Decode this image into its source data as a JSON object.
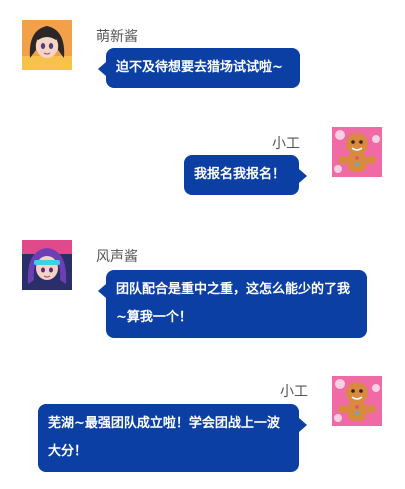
{
  "messages": [
    {
      "sender": "萌新酱",
      "text": "迫不及待想要去猎场试试啦~",
      "side": "left",
      "avatar": "anime-girl-avatar"
    },
    {
      "sender": "小工",
      "text": "我报名我报名！",
      "side": "right",
      "avatar": "gingerbread-avatar"
    },
    {
      "sender": "风声酱",
      "text": "团队配合是重中之重，这怎么能少的了我~算我一个！",
      "side": "left",
      "avatar": "purple-hair-girl-avatar"
    },
    {
      "sender": "小工",
      "text": "芜湖~最强团队成立啦！学会团战上一波大分！",
      "side": "right",
      "avatar": "gingerbread-avatar"
    }
  ],
  "colors": {
    "bubble": "#0b3fa3",
    "bubble_text": "#ffffff",
    "name": "#555555"
  }
}
